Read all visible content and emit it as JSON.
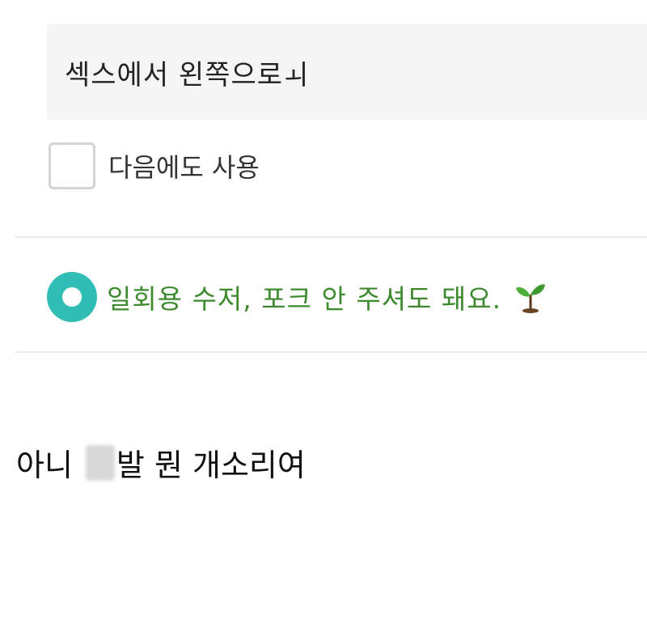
{
  "request": {
    "text": "섹스에서 왼쪽으로ㅚ"
  },
  "reuse_option": {
    "label": "다음에도 사용",
    "checked": false
  },
  "cutlery_option": {
    "label": "일회용 수저, 포크 안 주셔도 돼요.",
    "selected": true,
    "icon": "seedling-icon",
    "label_color": "#3e8a2f",
    "radio_color": "#2fbdb5"
  },
  "comment": {
    "before": "아니",
    "after": "발 뭔 개소리여"
  }
}
